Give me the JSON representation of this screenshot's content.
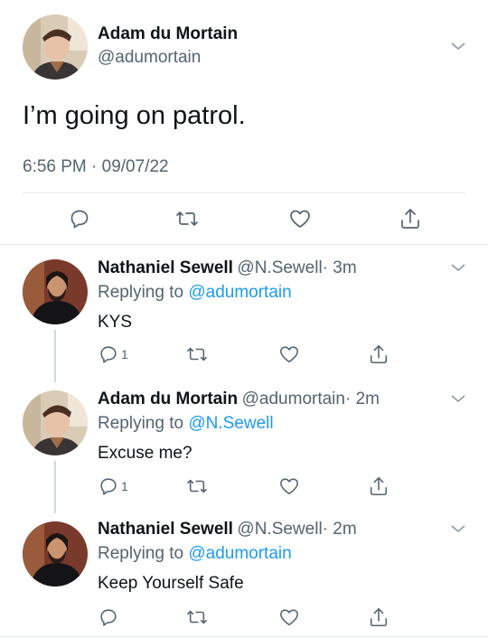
{
  "main_tweet": {
    "author_name": "Adam du Mortain",
    "author_handle": "@adumortain",
    "text": "I’m going on patrol.",
    "timestamp": "6:56 PM · 09/07/22"
  },
  "replies": [
    {
      "author_name": "Nathaniel Sewell",
      "author_handle": "@N.Sewell",
      "time": "· 3m",
      "replying_prefix": "Replying to",
      "replying_to": "@adumortain",
      "text": "KYS",
      "reply_count": "1"
    },
    {
      "author_name": "Adam du Mortain",
      "author_handle": "@adumortain",
      "time": "· 2m",
      "replying_prefix": "Replying to",
      "replying_to": "@N.Sewell",
      "text": "Excuse me?",
      "reply_count": "1"
    },
    {
      "author_name": "Nathaniel Sewell",
      "author_handle": "@N.Sewell",
      "time": "· 2m",
      "replying_prefix": "Replying to",
      "replying_to": "@adumortain",
      "text": "Keep Yourself Safe",
      "reply_count": ""
    }
  ],
  "icons": [
    "reply-icon",
    "retweet-icon",
    "like-icon",
    "share-icon",
    "chevron-down-icon"
  ],
  "colors": {
    "link": "#1d9bf0",
    "muted": "#536471",
    "text": "#0f1419",
    "divider": "#e6e9ec"
  }
}
